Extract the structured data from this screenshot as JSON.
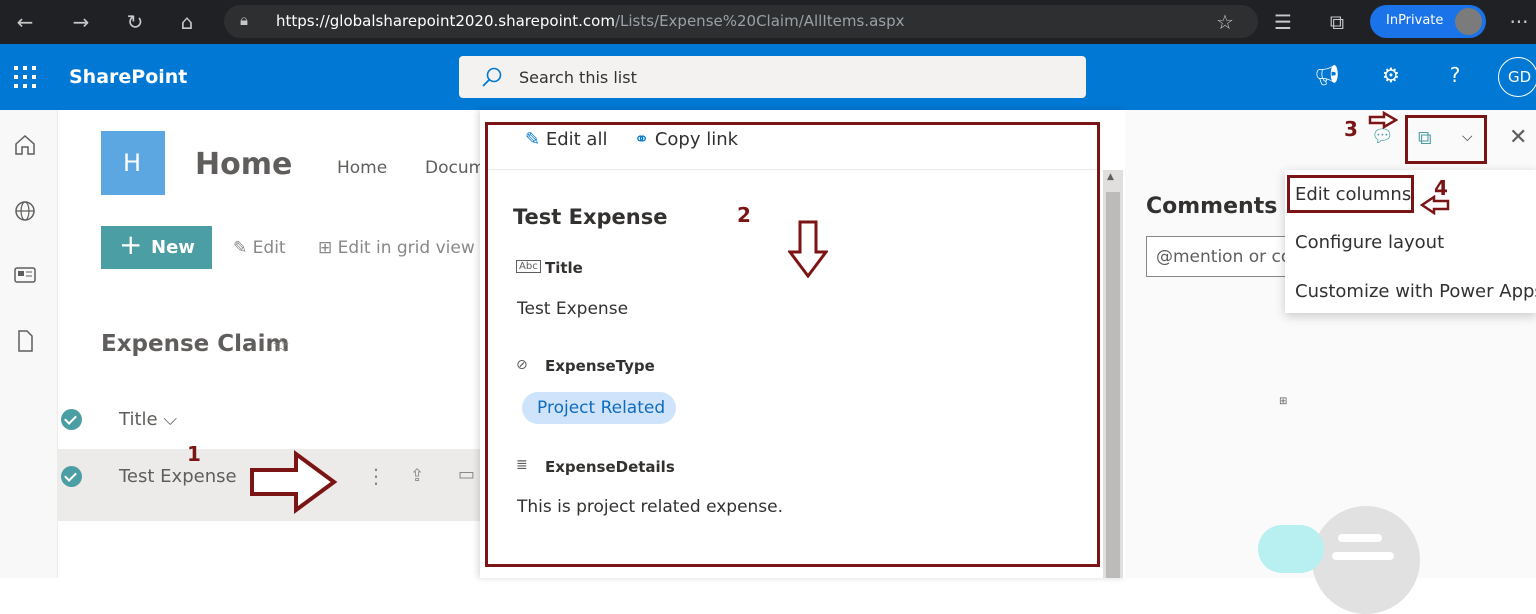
{
  "browser": {
    "url_host": "https://globalsharepoint2020.sharepoint.com",
    "url_path": "/Lists/Expense%20Claim/AllItems.aspx",
    "inprivate_label": "InPrivate",
    "more_label": "···"
  },
  "suite": {
    "app_name": "SharePoint",
    "search_placeholder": "Search this list",
    "avatar_initials": "GD",
    "help_label": "?"
  },
  "site": {
    "logo_letter": "H",
    "title": "Home",
    "nav": [
      "Home",
      "Docum"
    ]
  },
  "command_bar": {
    "new_label": "New",
    "edit_label": "Edit",
    "grid_label": "Edit in grid view"
  },
  "list": {
    "title": "Expense Claim",
    "column_header": "Title",
    "rows": [
      "Test Expense"
    ]
  },
  "detail": {
    "edit_all_label": "Edit all",
    "copy_link_label": "Copy link",
    "item_title": "Test Expense",
    "fields": [
      {
        "label": "Title",
        "value": "Test Expense",
        "icon": "text-field-icon"
      },
      {
        "label": "ExpenseType",
        "value": "Project Related",
        "icon": "choice-field-icon"
      },
      {
        "label": "ExpenseDetails",
        "value": "This is project related expense.",
        "icon": "multiline-field-icon"
      }
    ]
  },
  "comments": {
    "title": "Comments",
    "input_placeholder": "@mention or co"
  },
  "form_menu": {
    "items": [
      "Edit columns",
      "Configure layout",
      "Customize with Power Apps"
    ]
  },
  "annotations": [
    "1",
    "2",
    "3",
    "4"
  ],
  "colors": {
    "suite_blue": "#0078d4",
    "teal_accent": "#4b9ea3",
    "annotation_red": "#7b1515",
    "pill_bg": "#cfe4fa"
  }
}
